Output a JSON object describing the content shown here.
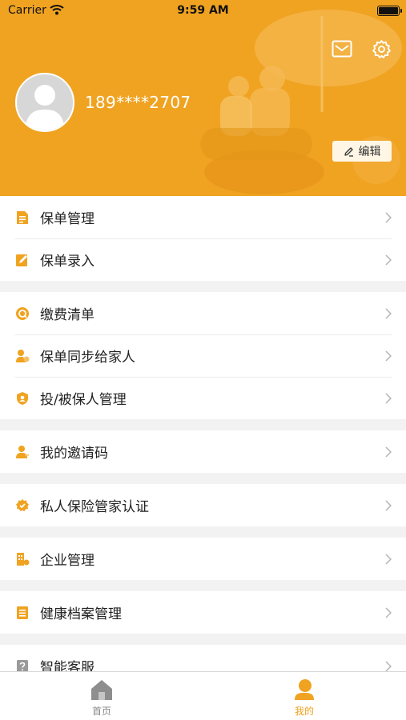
{
  "status_bar": {
    "carrier": "Carrier",
    "time": "9:59 AM"
  },
  "profile": {
    "phone": "189****2707",
    "edit_label": "编辑"
  },
  "colors": {
    "accent": "#f0a321",
    "background": "#f2f2f2"
  },
  "menu_groups": [
    [
      {
        "label": "保单管理",
        "icon": "document-icon"
      },
      {
        "label": "保单录入",
        "icon": "edit-document-icon"
      }
    ],
    [
      {
        "label": "缴费清单",
        "icon": "coin-icon"
      },
      {
        "label": "保单同步给家人",
        "icon": "family-sync-icon"
      },
      {
        "label": "投/被保人管理",
        "icon": "shield-user-icon"
      }
    ],
    [
      {
        "label": "我的邀请码",
        "icon": "invite-user-icon"
      }
    ],
    [
      {
        "label": "私人保险管家认证",
        "icon": "verified-badge-icon"
      }
    ],
    [
      {
        "label": "企业管理",
        "icon": "enterprise-icon"
      }
    ],
    [
      {
        "label": "健康档案管理",
        "icon": "health-record-icon"
      }
    ],
    [
      {
        "label": "智能客服",
        "icon": "help-icon"
      }
    ]
  ],
  "tabbar": {
    "home_label": "首页",
    "mine_label": "我的"
  }
}
